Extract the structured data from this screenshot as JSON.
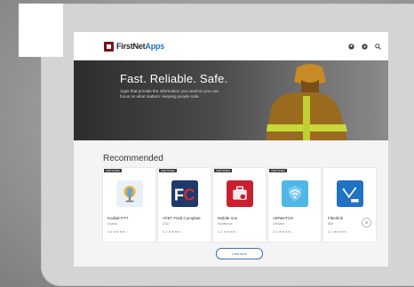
{
  "brand": {
    "logo_prefix": "FirstNet",
    "logo_suffix": "Apps"
  },
  "hero": {
    "title": "Fast. Reliable. Safe.",
    "subtitle": "Apps that provide the information you need so you can focus on what matters: keeping people safe."
  },
  "recommended": {
    "heading": "Recommended",
    "load_more": "Load more",
    "apps": [
      {
        "badge": "CERTIFIED",
        "name": "Kodiak PTT",
        "developer": "Kodiak",
        "rating": "4.5 ★★★★☆",
        "icon": "microphone-icon",
        "icon_bg": "#e9f1f8"
      },
      {
        "badge": "CERTIFIED",
        "name": "AT&T Field Complete",
        "developer": "AT&T",
        "rating": "4.2 ★★★★☆",
        "icon": "fc-logo-icon",
        "icon_bg": "#1d3a6b"
      },
      {
        "badge": "CERTIFIED",
        "name": "Mobile Iron",
        "developer": "MobileIron",
        "rating": "4.3 ★★★★☆",
        "icon": "briefcase-icon",
        "icon_bg": "#c9202f"
      },
      {
        "badge": "CERTIFIED",
        "name": "AIRWATCH",
        "developer": "VMWare",
        "rating": "4.4 ★★★★☆",
        "icon": "shield-wifi-icon",
        "icon_bg": "#4fb7e8"
      },
      {
        "badge": "",
        "name": "Fiberlink",
        "developer": "IBM",
        "rating": "4.1 ★★★★☆",
        "icon": "ibm-chart-icon",
        "icon_bg": "#1f72c4"
      }
    ]
  }
}
